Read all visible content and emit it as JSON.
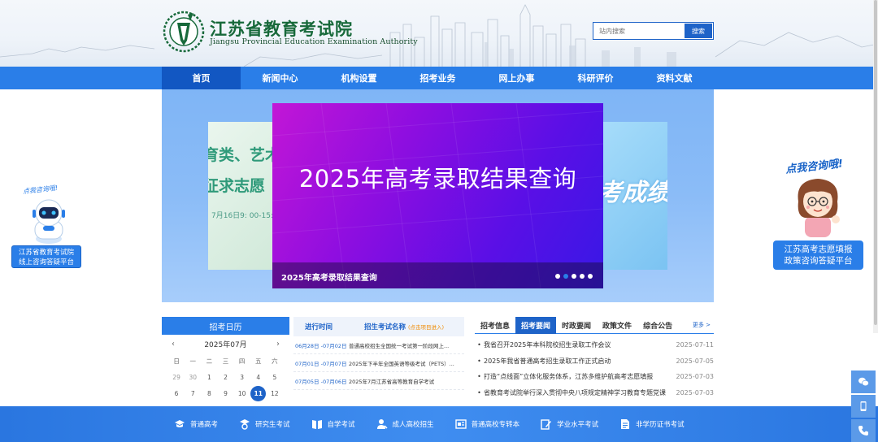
{
  "header": {
    "brand_cn": "江苏省教育考试院",
    "brand_en": "Jiangsu Provincial Education Examination Authority",
    "search_placeholder": "站内搜索",
    "search_button": "搜索"
  },
  "nav": {
    "items": [
      {
        "label": "首页",
        "active": true
      },
      {
        "label": "新闻中心"
      },
      {
        "label": "机构设置"
      },
      {
        "label": "招考业务"
      },
      {
        "label": "网上办事"
      },
      {
        "label": "科研评价"
      },
      {
        "label": "资料文献"
      }
    ]
  },
  "banner": {
    "main_title": "2025年高考录取结果查询",
    "caption": "2025年高考录取结果查询",
    "left_slide": {
      "line1": "育类、艺术",
      "line2": "征求志愿",
      "line3": "7月16日9: 00-15:"
    },
    "right_slide": {
      "text": "考成绩"
    },
    "dot_count": 5,
    "active_dot": 1
  },
  "promo_left": {
    "hint": "点我咨询哦!",
    "button_line1": "江苏省教育考试院",
    "button_line2": "线上咨询答疑平台"
  },
  "promo_right": {
    "hint": "点我咨询哦!",
    "button_line1": "江苏高考志愿填报",
    "button_line2": "政策咨询答疑平台"
  },
  "calendar": {
    "title": "招考日历",
    "month": "2025年07月",
    "weekdays": [
      "日",
      "一",
      "二",
      "三",
      "四",
      "五",
      "六"
    ],
    "days": [
      {
        "d": "29",
        "muted": true
      },
      {
        "d": "30",
        "muted": true
      },
      {
        "d": "1"
      },
      {
        "d": "2"
      },
      {
        "d": "3"
      },
      {
        "d": "4"
      },
      {
        "d": "5"
      },
      {
        "d": "6"
      },
      {
        "d": "7"
      },
      {
        "d": "8"
      },
      {
        "d": "9"
      },
      {
        "d": "10"
      },
      {
        "d": "11",
        "today": true
      },
      {
        "d": "12"
      }
    ]
  },
  "schedule": {
    "col_time": "进行时间",
    "col_name": "招生考试名称",
    "col_hint": "(点击项目进入)",
    "rows": [
      {
        "date": "06月28日 -07月02日",
        "name": "普通高校招生全国统一考试第一阶段网上..."
      },
      {
        "date": "07月01日 -07月07日",
        "name": "2025年下半年全国英语等级考试（PETS）..."
      },
      {
        "date": "07月05日 -07月06日",
        "name": "2025年7月江苏省高等教育自学考试"
      }
    ]
  },
  "news": {
    "tabs": [
      {
        "label": "招考信息"
      },
      {
        "label": "招考要闻",
        "active": true
      },
      {
        "label": "时政要闻"
      },
      {
        "label": "政策文件"
      },
      {
        "label": "综合公告"
      }
    ],
    "more": "更多 >",
    "items": [
      {
        "title": "我省召开2025年本科院校招生录取工作会议",
        "date": "2025-07-11"
      },
      {
        "title": "2025年我省普通高考招生录取工作正式启动",
        "date": "2025-07-05"
      },
      {
        "title": "打造“点线面”立体化服务体系，江苏多维护航高考志愿填报",
        "date": "2025-07-03"
      },
      {
        "title": "省教育考试院举行深入贯彻中央八项规定精神学习教育专题党课",
        "date": "2025-07-03"
      }
    ]
  },
  "bottom_bar": {
    "items": [
      {
        "label": "普通高考",
        "icon": "graduation-icon"
      },
      {
        "label": "研究生考试",
        "icon": "mortarboard-icon"
      },
      {
        "label": "自学考试",
        "icon": "book-icon"
      },
      {
        "label": "成人高校招生",
        "icon": "user-icon"
      },
      {
        "label": "普通高校专转本",
        "icon": "certificate-icon"
      },
      {
        "label": "学业水平考试",
        "icon": "pen-icon"
      },
      {
        "label": "非学历证书考试",
        "icon": "document-icon"
      }
    ]
  },
  "colors": {
    "primary": "#2a7ee8",
    "primary_dark": "#1257c2",
    "brand_green": "#17693a",
    "banner_purple": "#8e0ee0"
  }
}
